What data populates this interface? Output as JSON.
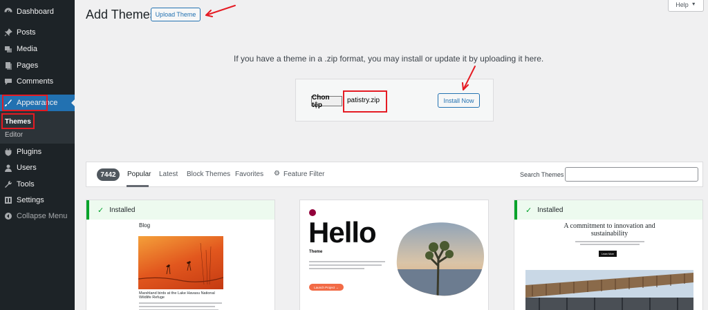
{
  "sidebar": {
    "items": [
      {
        "label": "Dashboard",
        "icon": "dashboard-icon"
      },
      {
        "label": "Posts",
        "icon": "pin-icon"
      },
      {
        "label": "Media",
        "icon": "media-icon"
      },
      {
        "label": "Pages",
        "icon": "pages-icon"
      },
      {
        "label": "Comments",
        "icon": "comment-icon"
      },
      {
        "label": "Appearance",
        "icon": "brush-icon"
      },
      {
        "label": "Plugins",
        "icon": "plugin-icon"
      },
      {
        "label": "Users",
        "icon": "users-icon"
      },
      {
        "label": "Tools",
        "icon": "wrench-icon"
      },
      {
        "label": "Settings",
        "icon": "settings-icon"
      },
      {
        "label": "Collapse Menu",
        "icon": "collapse-icon"
      }
    ],
    "submenu": [
      {
        "label": "Themes"
      },
      {
        "label": "Editor"
      }
    ]
  },
  "header": {
    "title": "Add Themes",
    "upload_button": "Upload Theme",
    "help_button": "Help",
    "help_caret": "▼"
  },
  "upload": {
    "help_text": "If you have a theme in a .zip format, you may install or update it by uploading it here.",
    "file_button": "Chon tệp",
    "file_name": "patistry.zip",
    "install_button": "Install Now"
  },
  "filter": {
    "count": "7442",
    "tabs": [
      "Popular",
      "Latest",
      "Block Themes",
      "Favorites"
    ],
    "feature_filter": "Feature Filter",
    "search_label": "Search Themes"
  },
  "themes": {
    "installed_label": "Installed",
    "card1": {
      "heading": "Blog",
      "post_title": "Marshland birds at the Lake Havasu National Wildlife Refuge"
    },
    "card2": {
      "hello": "Hello",
      "theme_label": "Theme",
      "button_label": "Launch Project →"
    },
    "card3": {
      "headline": "A commitment to innovation and sustainability",
      "button_label": "Learn More"
    }
  },
  "colors": {
    "sidebar_bg": "#1d2327",
    "accent": "#2271b1",
    "annotation": "#e51b23",
    "installed": "#00a32a"
  }
}
